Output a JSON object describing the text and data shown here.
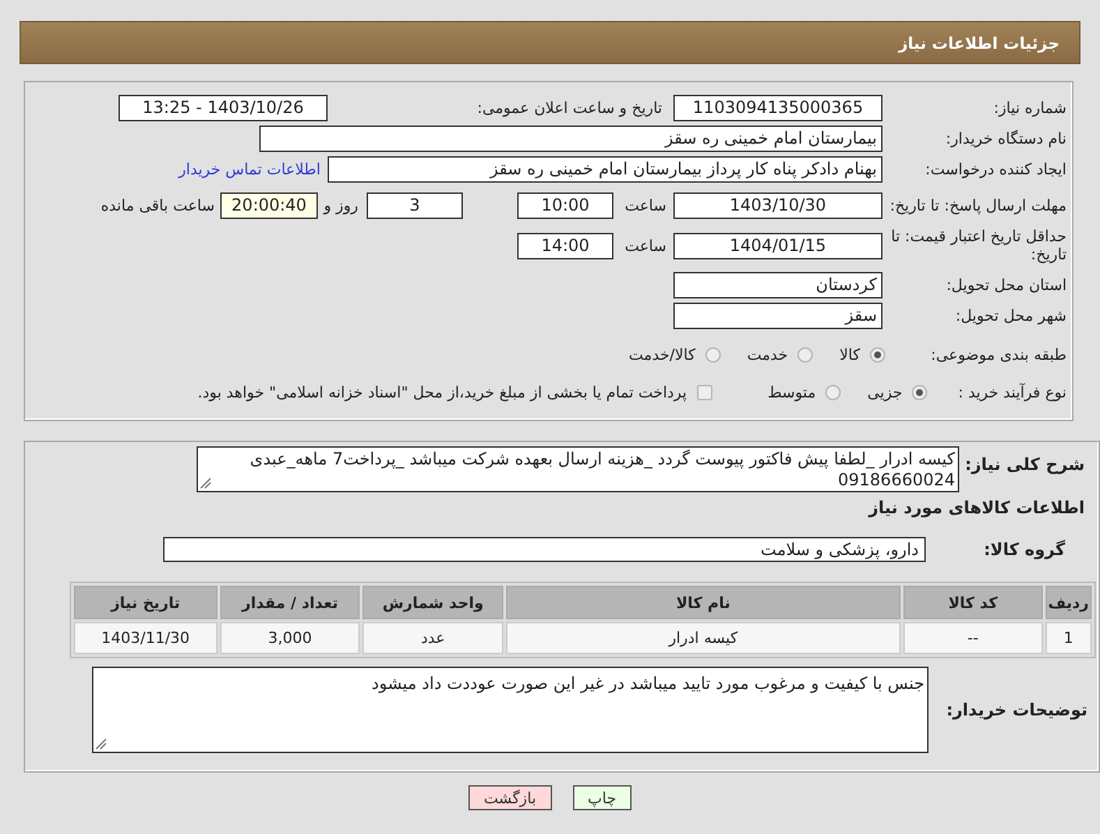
{
  "header": {
    "title": "جزئیات اطلاعات نیاز"
  },
  "need_number": {
    "label": "شماره نیاز:",
    "value": "1103094135000365"
  },
  "announce": {
    "label": "تاریخ و ساعت اعلان عمومی:",
    "value": "1403/10/26 - 13:25"
  },
  "buyer_org": {
    "label": "نام دستگاه خریدار:",
    "value": "بیمارستان امام خمینی  ره  سقز"
  },
  "requester": {
    "label": "ایجاد کننده درخواست:",
    "value": "بهنام دادکر پناه کار پرداز بیمارستان امام خمینی  ره  سقز",
    "link": "اطلاعات تماس خریدار"
  },
  "reply_deadline": {
    "label": "مهلت ارسال پاسخ: تا تاریخ:",
    "date": "1403/10/30",
    "time_label": "ساعت",
    "time": "10:00",
    "days": "3",
    "days_label": "روز و",
    "remaining": "20:00:40",
    "remaining_label": "ساعت باقی مانده"
  },
  "price_validity": {
    "label": "حداقل تاریخ اعتبار قیمت: تا تاریخ:",
    "date": "1404/01/15",
    "time_label": "ساعت",
    "time": "14:00"
  },
  "province": {
    "label": "استان محل تحویل:",
    "value": "کردستان"
  },
  "city": {
    "label": "شهر محل تحویل:",
    "value": "سقز"
  },
  "category": {
    "label": "طبقه بندی موضوعی:",
    "options": [
      {
        "label": "کالا",
        "selected": true
      },
      {
        "label": "خدمت",
        "selected": false
      },
      {
        "label": "کالا/خدمت",
        "selected": false
      }
    ]
  },
  "process": {
    "label": "نوع فرآیند خرید :",
    "options": [
      {
        "label": "جزیی",
        "selected": true
      },
      {
        "label": "متوسط",
        "selected": false
      }
    ],
    "treasury": {
      "label": "پرداخت تمام یا بخشی از مبلغ خرید،از محل \"اسناد خزانه اسلامی\" خواهد بود.",
      "checked": false
    }
  },
  "description": {
    "label": "شرح کلی نیاز:",
    "value": "کیسه ادرار _لطفا پیش فاکتور پیوست گردد _هزینه ارسال بعهده شرکت میباشد _پرداخت7 ماهه_عبدی 09186660024"
  },
  "goods_title": "اطلاعات کالاهای مورد نیاز",
  "goods_group": {
    "label": "گروه کالا:",
    "value": "دارو، پزشکی و سلامت"
  },
  "table": {
    "columns": [
      "ردیف",
      "کد کالا",
      "نام کالا",
      "واحد شمارش",
      "تعداد / مقدار",
      "تاریخ نیاز"
    ],
    "rows": [
      [
        "1",
        "--",
        "کیسه ادرار",
        "عدد",
        "3,000",
        "1403/11/30"
      ]
    ]
  },
  "buyer_notes": {
    "label": "توضیحات خریدار:",
    "value": "جنس با کیفیت و مرغوب مورد تایید میباشد در  غیر این  صورت عوددت داد میشود"
  },
  "buttons": [
    {
      "label": "چاپ",
      "kind": "print"
    },
    {
      "label": "بازگشت",
      "kind": "back"
    }
  ]
}
